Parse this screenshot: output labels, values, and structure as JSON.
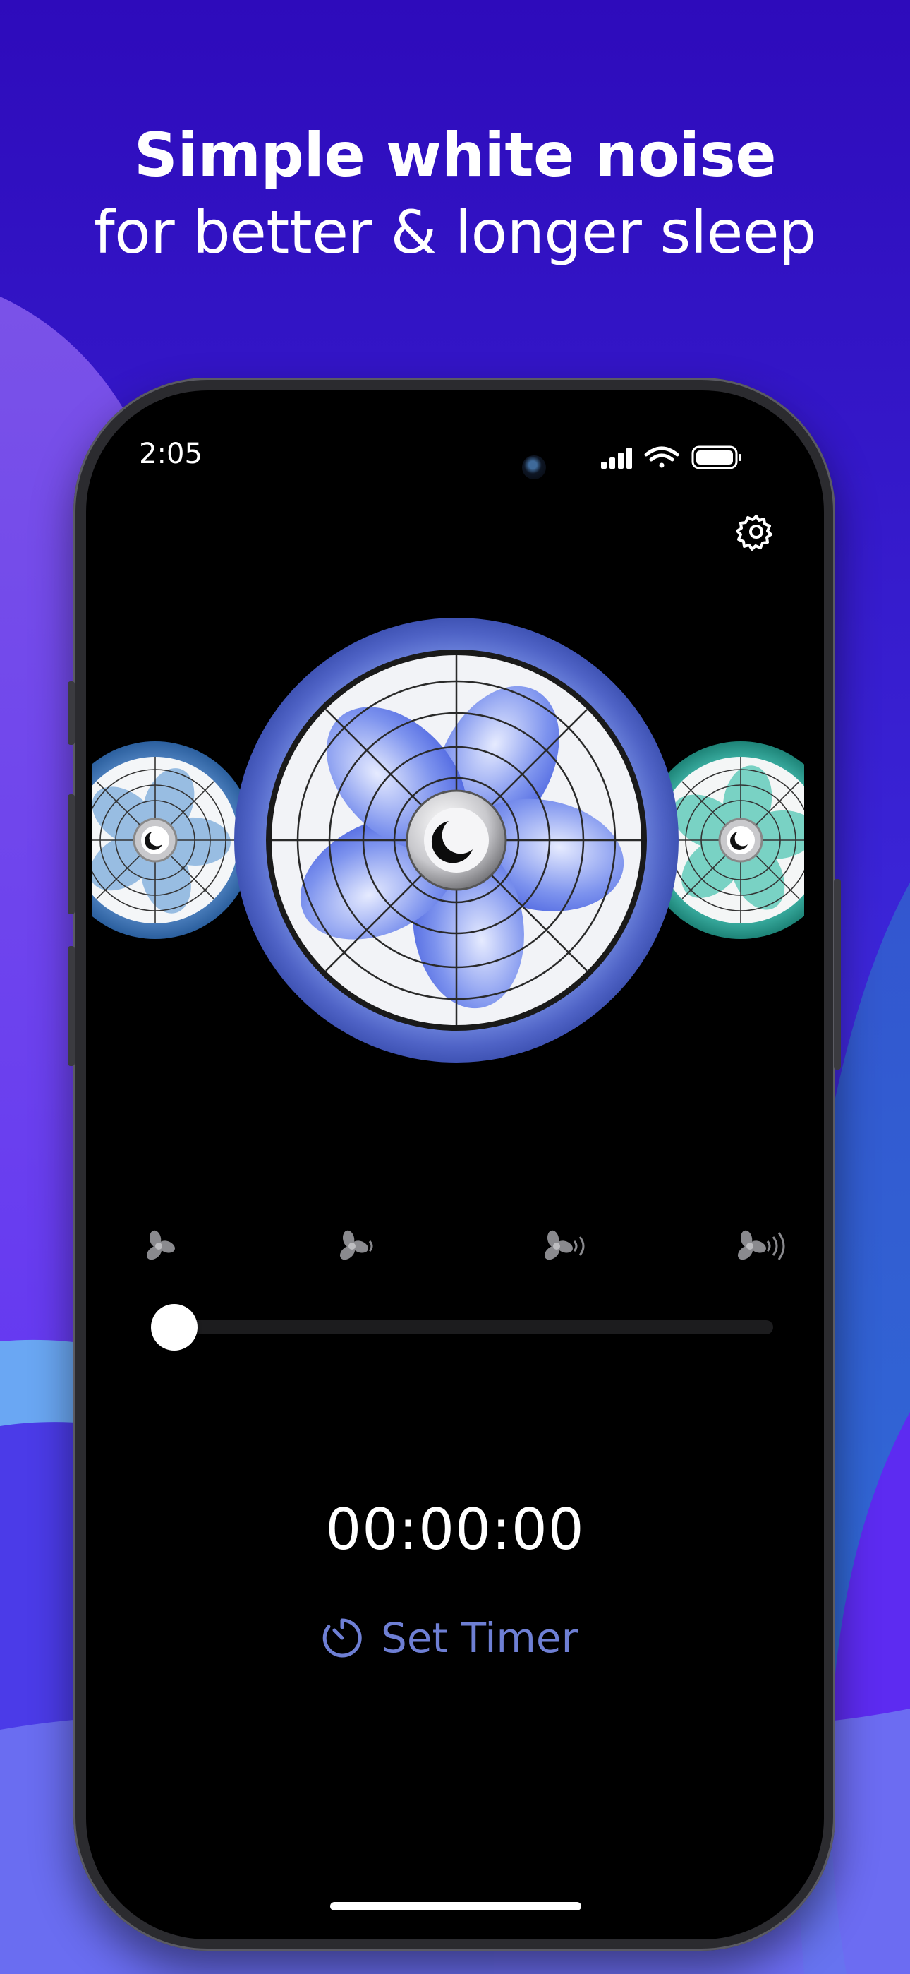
{
  "headline": {
    "line1": "Simple white noise",
    "line2": "for better & longer sleep"
  },
  "status_bar": {
    "time": "2:05",
    "icons": [
      "signal-icon",
      "wifi-icon",
      "battery-icon"
    ]
  },
  "toolbar": {
    "settings_icon": "gear-icon"
  },
  "fans": [
    {
      "name": "blue-grey-fan",
      "color": "#6aa0d8"
    },
    {
      "name": "blue-fan",
      "color": "#5a74e0",
      "selected": true
    },
    {
      "name": "teal-fan",
      "color": "#3fb8a8"
    }
  ],
  "speed": {
    "levels": [
      "fan-speed-0-icon",
      "fan-speed-1-icon",
      "fan-speed-2-icon",
      "fan-speed-3-icon"
    ],
    "value": 0
  },
  "timer": {
    "display": "00:00:00",
    "set_label": "Set Timer"
  },
  "colors": {
    "accent": "#6e7fd4",
    "background_top": "#2c0cbe",
    "screen": "#000000"
  }
}
